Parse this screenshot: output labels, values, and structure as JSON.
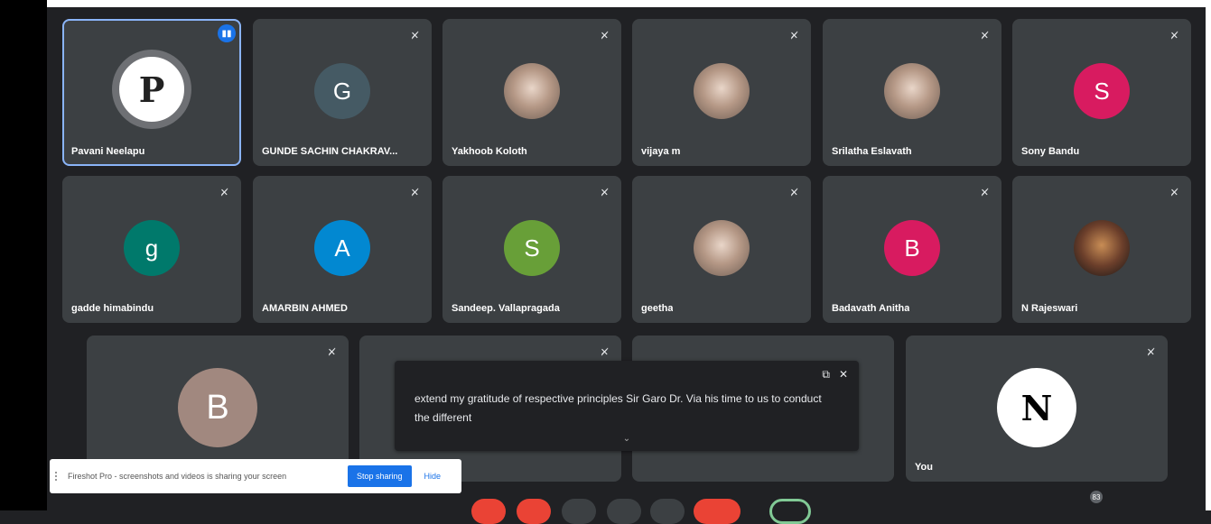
{
  "participants": [
    {
      "name": "Pavani Neelapu",
      "avatar": "P",
      "avatar_kind": "letter-p"
    },
    {
      "name": "GUNDE SACHIN CHAKRAV...",
      "avatar": "G",
      "avatar_color": "#455a64"
    },
    {
      "name": "Yakhoob Koloth",
      "avatar": "",
      "avatar_kind": "photo"
    },
    {
      "name": "vijaya m",
      "avatar": "",
      "avatar_kind": "photo"
    },
    {
      "name": "Srilatha Eslavath",
      "avatar": "",
      "avatar_kind": "photo"
    },
    {
      "name": "Sony Bandu",
      "avatar": "S",
      "avatar_color": "#d81b60"
    },
    {
      "name": "gadde himabindu",
      "avatar": "g",
      "avatar_color": "#00796b"
    },
    {
      "name": "AMARBIN AHMED",
      "avatar": "A",
      "avatar_color": "#0288d1"
    },
    {
      "name": "Sandeep. Vallapragada",
      "avatar": "S",
      "avatar_color": "#689f38"
    },
    {
      "name": "geetha",
      "avatar": "",
      "avatar_kind": "photo"
    },
    {
      "name": "Badavath Anitha",
      "avatar": "B",
      "avatar_color": "#d81b60"
    },
    {
      "name": "N Rajeswari",
      "avatar": "",
      "avatar_kind": "photo-dark"
    },
    {
      "name": "",
      "avatar": "B",
      "avatar_color": "#a1887f"
    },
    {
      "name": "You",
      "avatar": "N",
      "avatar_kind": "letter-n"
    }
  ],
  "caption": {
    "text": "extend my gratitude of respective principles Sir Garo Dr. Via his time to us to conduct the different"
  },
  "share_bar": {
    "message": "Fireshot Pro - screenshots and videos is sharing your screen",
    "stop_label": "Stop sharing",
    "hide_label": "Hide"
  },
  "people_count": "83",
  "icons": {
    "speaking": "speaking-indicator-icon",
    "mic_off": "mic-off-icon",
    "pop_out": "pop-out-icon",
    "close": "close-icon",
    "chevron": "chevron-down-icon"
  },
  "colors": {
    "background": "#202124",
    "tile": "#3c4043",
    "active_outline": "#8ab4f8",
    "accent": "#1a73e8",
    "end_call": "#ea4335"
  }
}
